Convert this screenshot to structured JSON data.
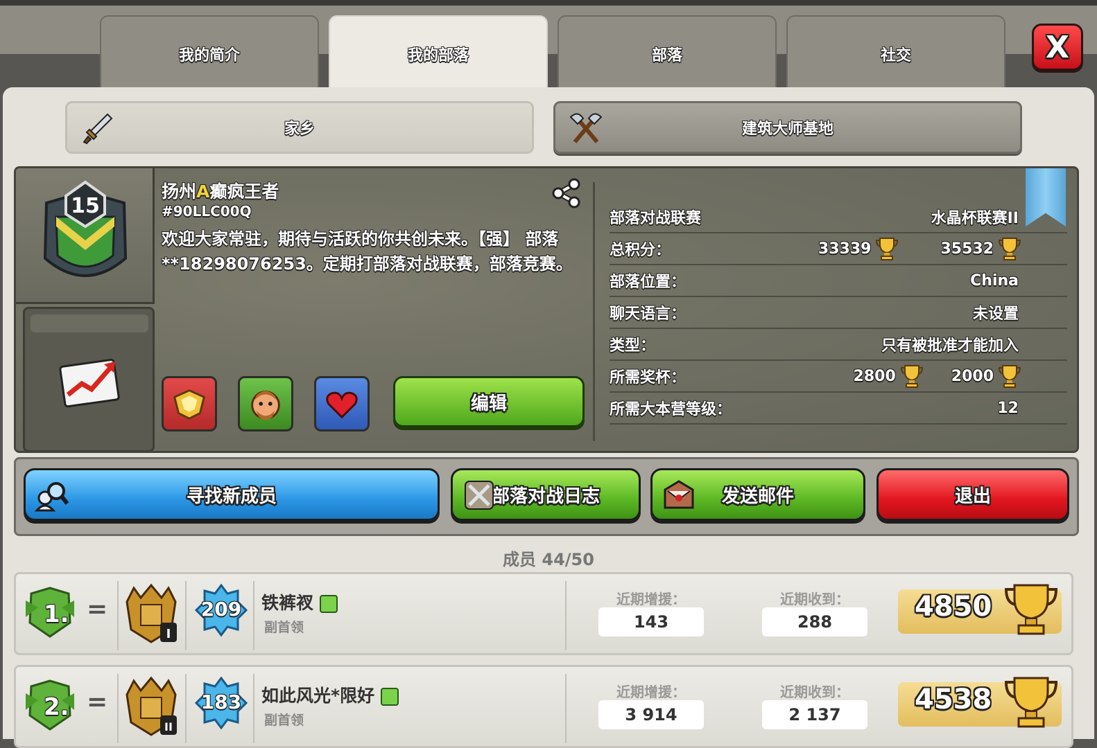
{
  "tabs": [
    {
      "label": "我的简介"
    },
    {
      "label": "我的部落"
    },
    {
      "label": "部落"
    },
    {
      "label": "社交"
    }
  ],
  "close_label": "X",
  "subtabs": {
    "home": "家乡",
    "builder": "建筑大师基地"
  },
  "clan": {
    "level": "15",
    "name_prefix": "扬州",
    "name_letter": "A",
    "name_suffix": "癫疯王者",
    "tag": "#90LLC00Q",
    "description": "欢迎大家常驻，期待与活跃的你共创未来。【强】 部落**18298076253。定期打部落对战联赛，部落竞赛。"
  },
  "edit_label": "编辑",
  "info": {
    "league_label": "部落对战联赛",
    "league_value": "水晶杯联赛II",
    "points_label": "总积分：",
    "points_home": "33339",
    "points_builder": "35532",
    "location_label": "部落位置：",
    "location_value": "China",
    "language_label": "聊天语言：",
    "language_value": "未设置",
    "type_label": "类型：",
    "type_value": "只有被批准才能加入",
    "trophies_label": "所需奖杯：",
    "trophies_home": "2800",
    "trophies_builder": "2000",
    "th_label": "所需大本营等级：",
    "th_value": "12"
  },
  "actions": {
    "find": "寻找新成员",
    "war_log": "部落对战日志",
    "mail": "发送邮件",
    "leave": "退出"
  },
  "members_count": "成员 44/50",
  "members": [
    {
      "rank": "1.",
      "xp": "209",
      "th_level": "I",
      "name": "铁裤衩",
      "role": "副首领",
      "donated_label": "近期增援：",
      "donated": "143",
      "received_label": "近期收到：",
      "received": "288",
      "trophies": "4850"
    },
    {
      "rank": "2.",
      "xp": "183",
      "th_level": "II",
      "name": "如此风光*限好",
      "role": "副首领",
      "donated_label": "近期增援：",
      "donated": "3 914",
      "received_label": "近期收到：",
      "received": "2 137",
      "trophies": "4538"
    }
  ],
  "colors": {
    "blue_button": "#2b97e6",
    "green_button": "#5cb824",
    "red_button": "#e3161f",
    "gold": "#e3bd5e"
  }
}
